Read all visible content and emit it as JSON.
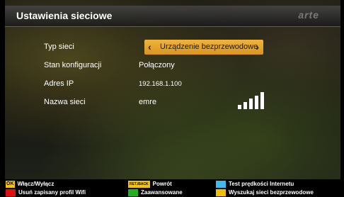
{
  "header": {
    "title": "Ustawienia sieciowe",
    "channel_logo": "arte"
  },
  "settings": {
    "network_type": {
      "label": "Typ sieci",
      "value": "Urządzenie bezprzewodowe"
    },
    "config_state": {
      "label": "Stan konfiguracji",
      "value": "Połączony"
    },
    "ip_address": {
      "label": "Adres IP",
      "value": "192.168.1.100"
    },
    "network_name": {
      "label": "Nazwa sieci",
      "value": "emre",
      "signal_bars": 5,
      "signal_strength_level": 5
    }
  },
  "footer": {
    "keys": [
      {
        "badge": "OK",
        "color": "#f5c400",
        "label": "Włącz/Wyłącz"
      },
      {
        "badge": "RET./BACK",
        "color": "#f5c400",
        "label": "Powrót"
      },
      {
        "badge": "",
        "color": "#40b8f0",
        "label": "Test prędkości Internetu"
      },
      {
        "badge": "",
        "color": "#e01010",
        "label": "Usuń zapisany profil Wifi"
      },
      {
        "badge": "",
        "color": "#20b020",
        "label": "Zaawansowane"
      },
      {
        "badge": "",
        "color": "#f0c000",
        "label": "Wyszukaj sieci bezprzewodowe"
      }
    ]
  }
}
